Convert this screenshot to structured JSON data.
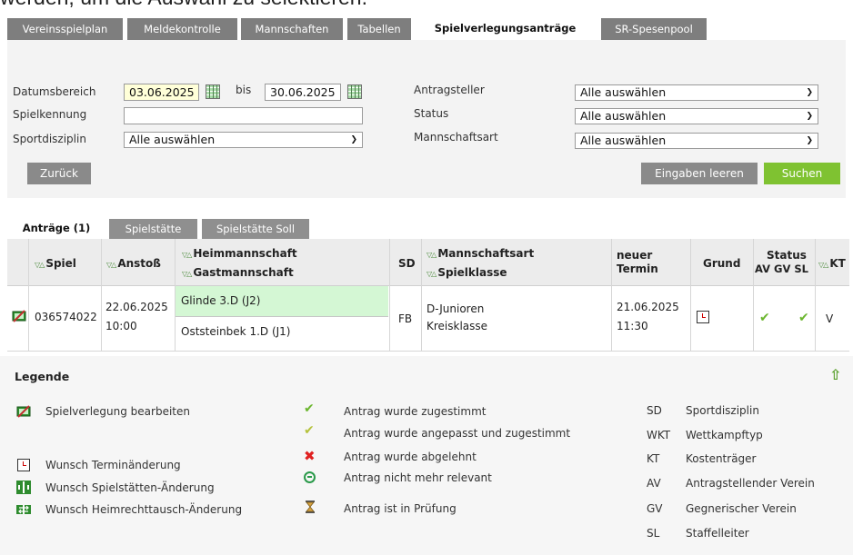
{
  "intro_text": "werden, um die Auswahl zu selektieren.",
  "main_tabs": [
    "Vereinsspielplan",
    "Meldekontrolle",
    "Mannschaften",
    "Tabellen",
    "Spielverlegungsanträge",
    "SR-Spesenpool"
  ],
  "filter": {
    "date_range_label": "Datumsbereich",
    "date_from": "03.06.2025",
    "bis_label": "bis",
    "date_to": "30.06.2025",
    "game_id_label": "Spielkennung",
    "game_id_value": "",
    "discipline_label": "Sportdisziplin",
    "discipline_value": "Alle auswählen",
    "applicant_label": "Antragsteller",
    "applicant_value": "Alle auswählen",
    "status_label": "Status",
    "status_value": "Alle auswählen",
    "team_type_label": "Mannschaftsart",
    "team_type_value": "Alle auswählen",
    "back_button": "Zurück",
    "clear_button": "Eingaben leeren",
    "search_button": "Suchen"
  },
  "sub_tabs": [
    "Anträge (1)",
    "Spielstätte",
    "Spielstätte Soll"
  ],
  "table": {
    "headers": {
      "spiel": "Spiel",
      "anstoss": "Anstoß",
      "heim": "Heimmannschaft",
      "gast": "Gastmannschaft",
      "sd": "SD",
      "mannschaftsart": "Mannschaftsart",
      "spielklasse": "Spielklasse",
      "neuer_termin_1": "neuer",
      "neuer_termin_2": "Termin",
      "grund": "Grund",
      "status": "Status",
      "status_sub": "AV GV SL",
      "kt": "KT"
    },
    "row": {
      "spiel": "036574022",
      "anstoss_date": "22.06.2025",
      "anstoss_time": "10:00",
      "heim": "Glinde 3.D (J2)",
      "gast": "Oststeinbek 1.D (J1)",
      "sd": "FB",
      "mannschaftsart": "D-Junioren",
      "spielklasse": "Kreisklasse",
      "neuer_termin_date": "21.06.2025",
      "neuer_termin_time": "11:30",
      "kt": "V"
    }
  },
  "legend": {
    "title": "Legende",
    "col1": [
      {
        "icon": "edit-game-icon",
        "text": "Spielverlegung bearbeiten"
      },
      {
        "icon": "date-change-icon",
        "text": "Wunsch Terminänderung"
      },
      {
        "icon": "venue-change-icon",
        "text": "Wunsch Spielstätten-Änderung"
      },
      {
        "icon": "home-swap-icon",
        "text": "Wunsch Heimrechttausch-Änderung"
      }
    ],
    "col2": [
      {
        "icon": "check-icon",
        "text": "Antrag wurde zugestimmt"
      },
      {
        "icon": "check-adjusted-icon",
        "text": "Antrag wurde angepasst und zugestimmt"
      },
      {
        "icon": "cross-icon",
        "text": "Antrag wurde abgelehnt"
      },
      {
        "icon": "not-relevant-icon",
        "text": "Antrag nicht mehr relevant"
      },
      {
        "icon": "hourglass-icon",
        "text": "Antrag ist in Prüfung"
      }
    ],
    "col3": [
      {
        "abbr": "SD",
        "text": "Sportdisziplin"
      },
      {
        "abbr": "WKT",
        "text": "Wettkampftyp"
      },
      {
        "abbr": "KT",
        "text": "Kostenträger"
      },
      {
        "abbr": "AV",
        "text": "Antragstellender Verein"
      },
      {
        "abbr": "GV",
        "text": "Gegnerischer Verein"
      },
      {
        "abbr": "SL",
        "text": "Staffelleiter"
      }
    ]
  },
  "colors": {
    "tab_grey": "#7e7e7e",
    "search_green": "#7fc231",
    "home_highlight": "#d4f7d4",
    "check_green": "#6bb62e",
    "reject_red": "#e02020"
  }
}
